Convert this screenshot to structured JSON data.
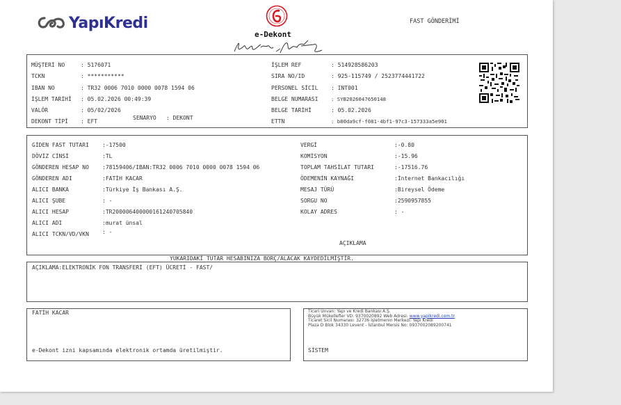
{
  "header": {
    "logo_text": "YapıKredi",
    "doc_title": "e-Dekont",
    "right_title": "FAST GÖNDERİMİ"
  },
  "customer": {
    "left": [
      {
        "label": "MÜŞTERİ NO",
        "value": ": 5176071"
      },
      {
        "label": "TCKN",
        "value": ": ***********"
      },
      {
        "label": "IBAN NO",
        "value": ": TR32 0006 7010 0000 0078 1594 06"
      },
      {
        "label": "İŞLEM TARİHİ",
        "value": ": 05.02.2026 00:49:39"
      },
      {
        "label": "VALÖR",
        "value": ": 05/02/2026"
      },
      {
        "label": "DEKONT TİPİ",
        "value": ": EFT"
      }
    ],
    "scenario_label": "SENARYO",
    "scenario_value": ": DEKONT",
    "right": [
      {
        "label": "İŞLEM REF",
        "value": ": 514928586203"
      },
      {
        "label": "SIRA NO/ID",
        "value": ": 925-115749 / 2523774441722"
      },
      {
        "label": "PERSONEL SİCİL",
        "value": ": INT001"
      },
      {
        "label": "BELGE NUMARASI",
        "value": ": SYB2026047650148"
      },
      {
        "label": "BELGE TARİHİ",
        "value": ": 05.02.2026"
      },
      {
        "label": "ETTN",
        "value": ": b80da9cf-f081-4bf1-97c3-157333a5e901"
      }
    ]
  },
  "transfer": {
    "left": [
      {
        "label": "GİDEN FAST TUTARI",
        "value": ":-17500"
      },
      {
        "label": "DÖVİZ CİNSİ",
        "value": ":TL"
      },
      {
        "label": "GÖNDEREN HESAP NO",
        "value": ":78159406/IBAN:TR32 0006 7010 0000 0078 1594 06"
      },
      {
        "label": "GÖNDEREN ADI",
        "value": ":FATİH KACAR"
      },
      {
        "label": "ALICI BANKA",
        "value": ":Türkiye İş Bankası A.Ş."
      },
      {
        "label": "ALICI ŞUBE",
        "value": ": -"
      },
      {
        "label": "ALICI HESAP",
        "value": ":TR200006400000161240705840"
      },
      {
        "label": "ALICI ADI",
        "value": ":murat ünsal"
      },
      {
        "label": "ALICI TCKN/VD/VKN",
        "value": ": -"
      }
    ],
    "right": [
      {
        "label": "VERGİ",
        "value": ":-0.80"
      },
      {
        "label": "KOMİSYON",
        "value": ":-15.96"
      },
      {
        "label": "TOPLAM TAHSİLAT TUTARI",
        "value": ":-17516.76"
      },
      {
        "label": "ÖDEMENİN KAYNAĞI",
        "value": ":İnternet Bankacılığı"
      },
      {
        "label": "MESAJ TÜRÜ",
        "value": ":Bireysel Ödeme"
      },
      {
        "label": "SORGU NO",
        "value": ":2590957855"
      },
      {
        "label": "KOLAY ADRES",
        "value": ": -"
      }
    ],
    "explanation_header": "AÇIKLAMA"
  },
  "notice": "YUKARIDAKİ TUTAR HESABINIZA BORÇ/ALACAK KAYDEDİLMİŞTİR.",
  "description": "AÇIKLAMA:ELEKTRONİK FON TRANSFERİ (EFT) ÜCRETİ - FAST/",
  "footer": {
    "name": "FATİH KACAR",
    "note": "e-Dekont izni kapsamında elektronik ortamda üretilmiştir.",
    "company_line1": "Ticari Unvan: Yapı ve Kredi Bankası A.Ş.",
    "company_line2_pre": "Büyük Mükellefler VD: 9370020892 Web Adresi: ",
    "company_link": "www.yapikredi.com.tr",
    "company_line3": "Ticaret Sicil Numarası: 32736 İşletmenin Merkezi: Yapı Kredi",
    "company_line4": "Plaza D Blok 34330 Levent - İstanbul Mersis No: 0937002089200741",
    "system": "SİSTEM"
  },
  "colors": {
    "brand": "#2e3192",
    "seal_red": "#d71920",
    "border": "#555555"
  }
}
